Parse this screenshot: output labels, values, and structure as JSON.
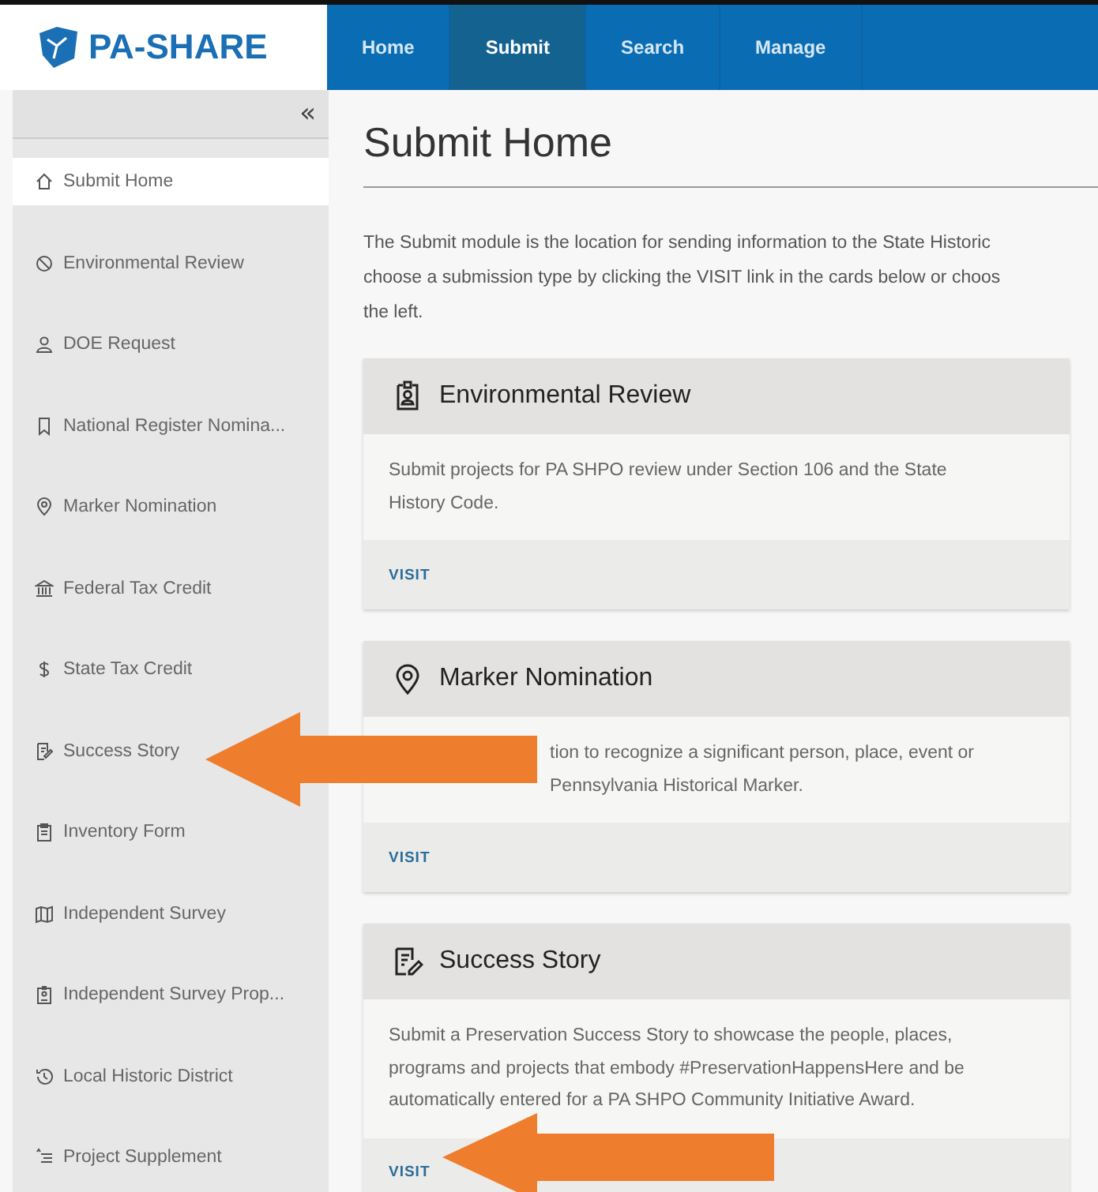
{
  "logo": {
    "text": "PA-SHARE"
  },
  "nav": [
    {
      "label": "Home",
      "selected": false
    },
    {
      "label": "Submit",
      "selected": true
    },
    {
      "label": "Search",
      "selected": false
    },
    {
      "label": "Manage",
      "selected": false
    }
  ],
  "sidebar": {
    "collapse": "«",
    "items": [
      {
        "label": "Submit Home",
        "selected": true
      },
      {
        "label": "Environmental Review",
        "selected": false
      },
      {
        "label": "DOE Request",
        "selected": false
      },
      {
        "label": "National Register Nomina...",
        "selected": false
      },
      {
        "label": "Marker Nomination",
        "selected": false
      },
      {
        "label": "Federal Tax Credit",
        "selected": false
      },
      {
        "label": "State Tax Credit",
        "selected": false
      },
      {
        "label": "Success Story",
        "selected": false
      },
      {
        "label": "Inventory Form",
        "selected": false
      },
      {
        "label": "Independent Survey",
        "selected": false
      },
      {
        "label": "Independent Survey Prop...",
        "selected": false
      },
      {
        "label": "Local Historic District",
        "selected": false
      },
      {
        "label": "Project Supplement",
        "selected": false
      }
    ]
  },
  "page": {
    "title": "Submit Home",
    "intro": [
      "The Submit module is the location for sending information to the State Historic",
      "choose a submission type by clicking the VISIT link in the cards below or choos",
      "the left."
    ]
  },
  "cards": [
    {
      "title": "Environmental Review",
      "description": [
        "Submit projects for PA SHPO review under Section 106 and the State",
        "History Code."
      ],
      "partly_covered": false,
      "link": "VISIT"
    },
    {
      "title": "Marker Nomination",
      "description": [
        "tion to recognize a significant person, place, event or",
        "Pennsylvania Historical Marker."
      ],
      "partly_covered": true,
      "link": "VISIT"
    },
    {
      "title": "Success Story",
      "description": [
        "Submit a Preservation Success Story to showcase the people, places,",
        "programs and projects that embody #PreservationHappensHere and be",
        "automatically entered for a PA SHPO Community Initiative Award."
      ],
      "partly_covered": false,
      "link": "VISIT"
    }
  ]
}
